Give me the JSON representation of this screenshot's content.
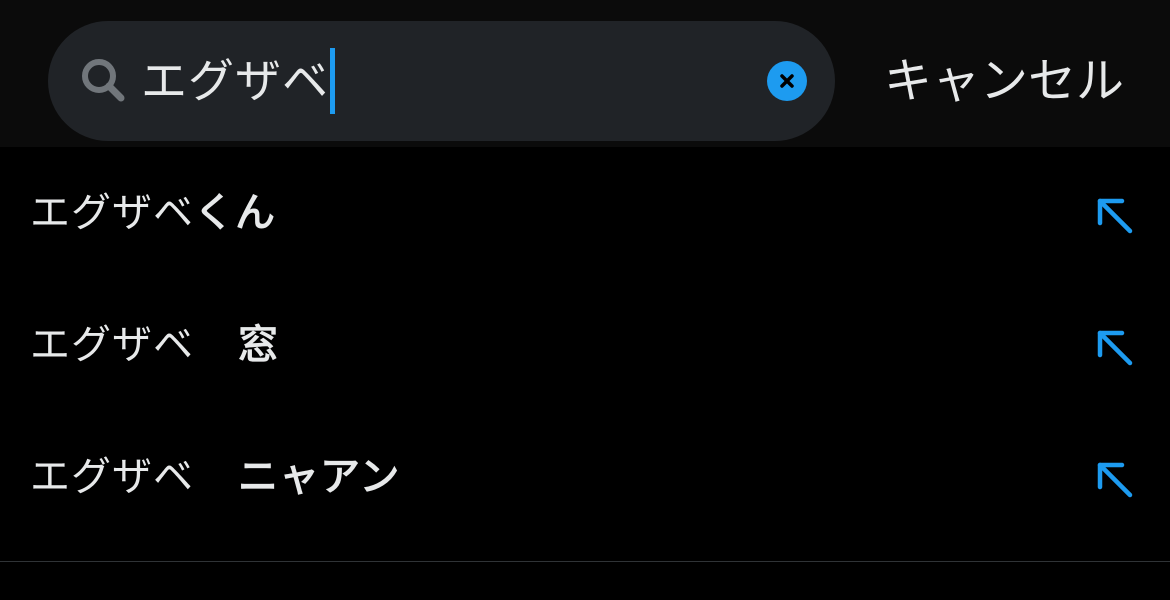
{
  "search": {
    "query": "エグザベ",
    "cancel_label": "キャンセル"
  },
  "suggestions": [
    {
      "prefix": "エグザベ",
      "completion": "くん",
      "spaced": false
    },
    {
      "prefix": "エグザベ",
      "completion": "窓",
      "spaced": true
    },
    {
      "prefix": "エグザベ",
      "completion": "ニャアン",
      "spaced": true
    }
  ],
  "icons": {
    "search": "search-icon",
    "clear": "clear-icon",
    "suggestion_fill": "arrow-up-left-icon"
  },
  "colors": {
    "accent": "#1d9bf0",
    "background": "#000000",
    "search_field": "#202327",
    "text": "#e7e9ea"
  }
}
